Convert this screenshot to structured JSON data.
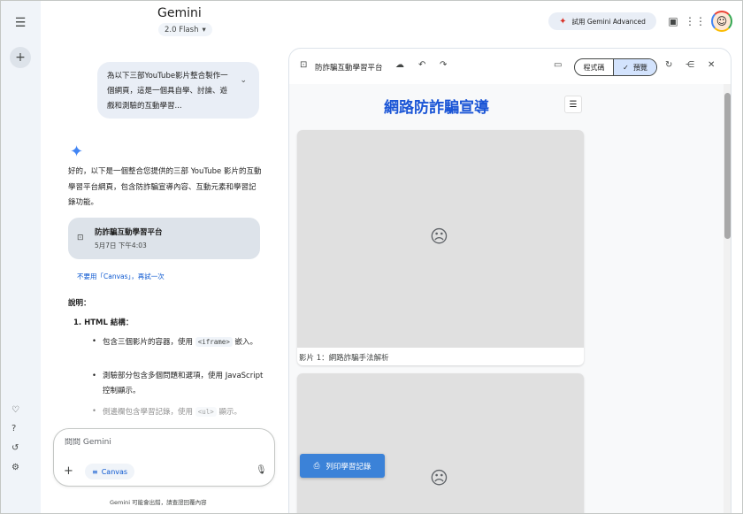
{
  "app": {
    "brand": "Gemini",
    "model": "2.0 Flash",
    "advanced_label": "試用 Gemini Advanced"
  },
  "icons": {
    "menu": "hamburger-icon",
    "new_chat": "plus-icon",
    "gem": "heart-icon",
    "help": "help-icon",
    "activity": "history-icon",
    "settings": "gear-icon",
    "advanced": "sparkle-icon",
    "case": "briefcase-icon",
    "apps": "apps-grid-icon"
  },
  "chat": {
    "user_prompt": "為以下三部YouTube影片整合製作一個網頁，這是一個具自學、討論、遊戲和測驗的互動學習...",
    "answer_intro": "好的，以下是一個整合您提供的三部 YouTube 影片的互動學習平台網頁，包含防詐騙宣導內容、互動元素和學習記錄功能。",
    "doc_card": {
      "title": "防詐騙互動學習平台",
      "time": "5月7日 下午4:03"
    },
    "retry_link": "不要用「Canvas」，再試一次",
    "section_title": "說明：",
    "ol_item": "1.  HTML 結構：",
    "bullets": [
      {
        "pre": "包含三個影片的容器，使用 ",
        "code": "<iframe>",
        "post": " 嵌入。"
      },
      {
        "pre": "測驗部分包含多個問題和選項，使用 JavaScript 控制顯示。",
        "code": "",
        "post": ""
      },
      {
        "pre": "側邊欄包含學習記錄，使用 ",
        "code": "<ul>",
        "post": " 顯示。"
      }
    ]
  },
  "composer": {
    "placeholder": "問問 Gemini",
    "canvas_label": "Canvas"
  },
  "disclaimer": "Gemini 可能會出錯，請查證回覆內容",
  "panel": {
    "title": "防詐騙互動學習平台",
    "code_tab": "程式碼",
    "preview_tab": "預覽"
  },
  "preview": {
    "page_title": "網路防詐騙宣導",
    "video1_caption": "影片 1：網路詐騙手法解析",
    "print_label": "列印學習記錄"
  },
  "colors": {
    "accent": "#0b57d0",
    "preview_title": "#1a55d6",
    "print_btn": "#3b82d8"
  }
}
